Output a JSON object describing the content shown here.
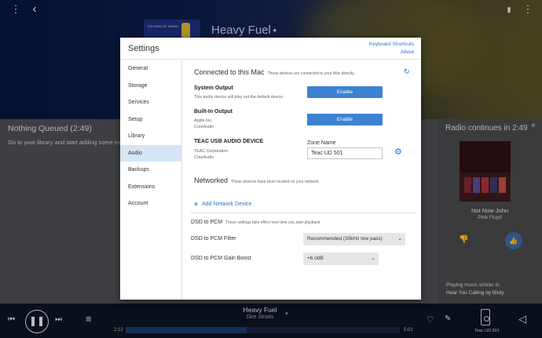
{
  "now_playing": {
    "album_band_text": "SULTANS OF SWING",
    "title": "Heavy Fuel",
    "artist": "Dire Straits",
    "time_elapsed": "2:12",
    "time_total": "5:01",
    "progress": 0.44,
    "zone": "Teac UD 501"
  },
  "queue": {
    "title": "Nothing Queued (2:49)",
    "subtitle": "Go to your library and start adding some m"
  },
  "radio": {
    "title": "Radio continues in 2:49",
    "song": "Not Now John",
    "artist": "Pink Floyd",
    "similar_label": "Playing music similar to",
    "similar_track": "Hear You Calling by Birdy"
  },
  "icons": {
    "back": "‹",
    "more": "⋮",
    "bookmark": "▮",
    "star": "✦",
    "close": "×",
    "prev": "⏮",
    "pause": "❚❚",
    "next": "⏭",
    "queue": "≡",
    "heart": "♡",
    "wand": "✎",
    "volume": "◁",
    "refresh": "↻",
    "gear": "⚙",
    "plus": "+",
    "chevron": "⌄",
    "thumb_down": "👎",
    "thumb_up": "👍"
  },
  "settings": {
    "title": "Settings",
    "keyboard_shortcuts": "Keyboard Shortcuts",
    "about": "About",
    "nav": [
      "General",
      "Storage",
      "Services",
      "Setup",
      "Library",
      "Audio",
      "Backups",
      "Extensions",
      "Account"
    ],
    "active_nav": "Audio",
    "connected": {
      "heading": "Connected to this Mac",
      "note": "These devices are connected to your Mac directly."
    },
    "devices": [
      {
        "name": "System Output",
        "sub1": "This audio device will play out the default device.",
        "sub2": "",
        "button": "Enable"
      },
      {
        "name": "Built-In Output",
        "sub1": "Apple Inc.",
        "sub2": "CoreAudio",
        "button": "Enable"
      },
      {
        "name": "TEAC USB AUDIO DEVICE",
        "sub1": "TEAC Corporation",
        "sub2": "CoreAudio",
        "zone_label": "Zone Name",
        "zone_value": "Teac UD 501"
      }
    ],
    "networked": {
      "heading": "Networked",
      "note": "These devices have been located on your network.",
      "add_label": "Add Network Device"
    },
    "dsd": {
      "heading": "DSD to PCM",
      "note": "These settings take effect next time you start playback.",
      "filter_label": "DSD to PCM Filter",
      "filter_value": "Recommended (30kHz low pass)",
      "gain_label": "DSD to PCM Gain Boost",
      "gain_value": "+6.0dB"
    }
  }
}
